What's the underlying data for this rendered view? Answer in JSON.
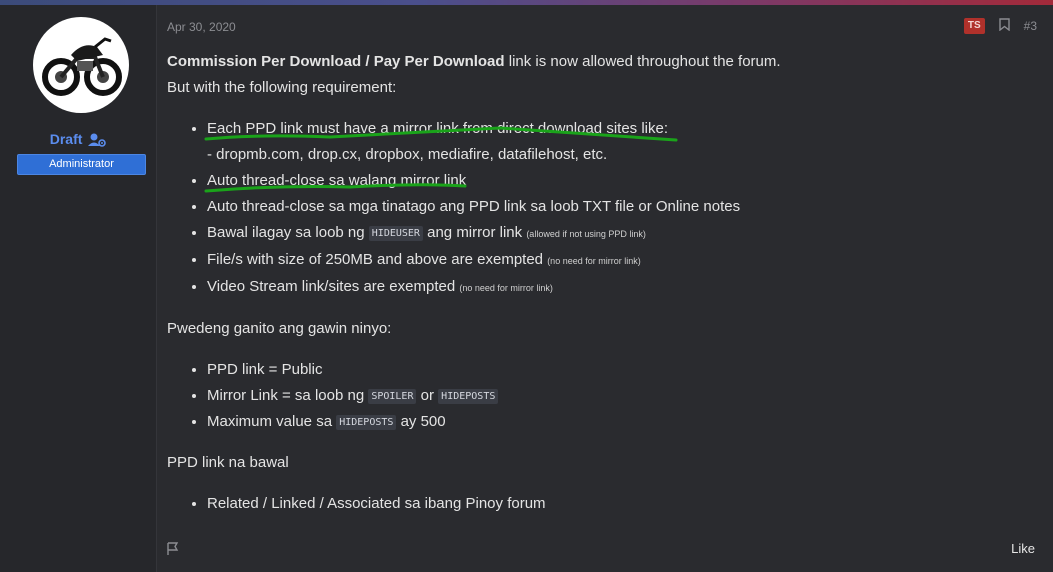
{
  "post": {
    "date": "Apr 30, 2020",
    "ts_badge": "TS",
    "post_number": "#3",
    "like_label": "Like"
  },
  "user": {
    "name": "Draft",
    "role": "Administrator"
  },
  "content": {
    "intro_bold": "Commission Per Download / Pay Per Download",
    "intro_rest": " link is now allowed throughout the forum.",
    "intro_line2": "But with the following requirement:",
    "req1": "Each PPD link must have a mirror link from direct download sites like:",
    "req1_sub": "- dropmb.com, drop.cx, dropbox, mediafire, datafilehost, etc.",
    "req2": "Auto thread-close sa walang mirror link",
    "req3": "Auto thread-close sa mga tinatago ang PPD link sa loob TXT file or Online notes",
    "req4_pre": "Bawal ilagay sa loob ng ",
    "req4_code": "HIDEUSER",
    "req4_post": " ang mirror link ",
    "req4_small": "(allowed if not using PPD link)",
    "req5": "File/s with size of 250MB and above are exempted ",
    "req5_small": "(no need for mirror link)",
    "req6": "Video Stream link/sites are exempted ",
    "req6_small": "(no need for mirror link)",
    "section2": "Pwedeng ganito ang gawin ninyo:",
    "opt1": "PPD link = Public",
    "opt2_pre": "Mirror Link = sa loob ng ",
    "opt2_code1": "SPOILER",
    "opt2_mid": " or ",
    "opt2_code2": "HIDEPOSTS",
    "opt3_pre": "Maximum value sa ",
    "opt3_code": "HIDEPOSTS",
    "opt3_post": " ay 500",
    "section3": "PPD link na bawal",
    "ban1": "Related / Linked / Associated sa ibang Pinoy forum"
  },
  "colors": {
    "username": "#5b8def",
    "role_badge": "#2f6fd6",
    "ts_badge": "#b0312b",
    "highlight_underline": "#1aa31a"
  },
  "icons": [
    "user-cog-icon",
    "bookmark-icon",
    "flag-icon",
    "motorcycle-avatar"
  ]
}
